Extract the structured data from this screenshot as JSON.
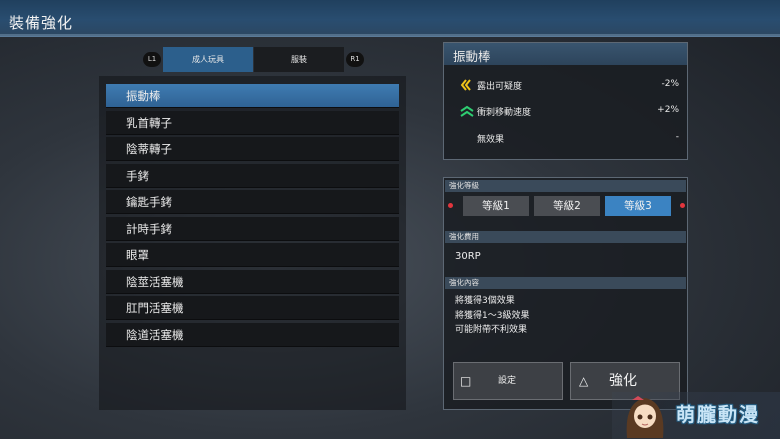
{
  "header": {
    "title": "裝備強化"
  },
  "tabs": {
    "left_bumper": "L1",
    "right_bumper": "R1",
    "items": [
      {
        "label": "成人玩具",
        "active": true
      },
      {
        "label": "服裝",
        "active": false
      }
    ]
  },
  "equipment_list": [
    {
      "label": "振動棒",
      "selected": true
    },
    {
      "label": "乳首轉子"
    },
    {
      "label": "陰蒂轉子"
    },
    {
      "label": "手銬"
    },
    {
      "label": "鑰匙手銬"
    },
    {
      "label": "計時手銬"
    },
    {
      "label": "眼罩"
    },
    {
      "label": "陰莖活塞機"
    },
    {
      "label": "肛門活塞機"
    },
    {
      "label": "陰道活塞機"
    }
  ],
  "detail": {
    "title": "振動棒",
    "effects": [
      {
        "icon": "yellow-double-chevron-left-icon",
        "label": "露出可疑度",
        "value": "-2%"
      },
      {
        "icon": "green-double-chevron-up-icon",
        "label": "衝刺移動速度",
        "value": "+2%"
      },
      {
        "icon": "",
        "label": "無效果",
        "value": "-"
      }
    ]
  },
  "upgrade": {
    "level_header": "強化等級",
    "levels": [
      {
        "label": "等級1",
        "active": false
      },
      {
        "label": "等級2",
        "active": false
      },
      {
        "label": "等級3",
        "active": true
      }
    ],
    "cost_header": "強化費用",
    "cost": "30RP",
    "content_header": "強化內容",
    "content_lines": [
      "將獲得3個效果",
      "將獲得1～3級效果",
      "可能附帶不利效果"
    ],
    "buttons": {
      "settings": {
        "glyph": "□",
        "label": "設定"
      },
      "upgrade": {
        "glyph": "△",
        "label": "強化"
      }
    }
  },
  "watermark": {
    "text": "萌朧動漫"
  },
  "colors": {
    "accent": "#3b83c2",
    "header_bar": "#294d70",
    "effect_down": "#f0c419",
    "effect_up": "#2ecc71",
    "indicator_red": "#e2353d"
  }
}
